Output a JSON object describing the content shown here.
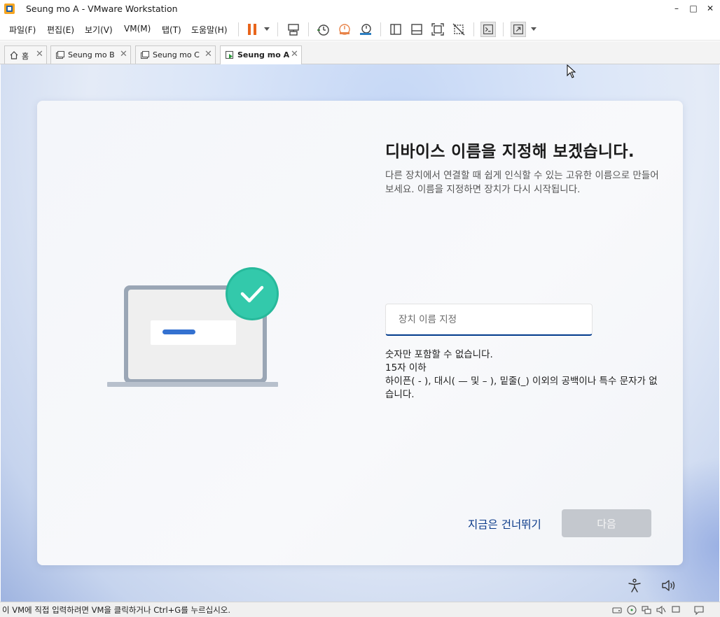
{
  "window": {
    "title": "Seung mo A - VMware Workstation",
    "minimize": "–",
    "maximize": "□",
    "close": "✕"
  },
  "menu": {
    "items": [
      "파일(F)",
      "편집(E)",
      "보기(V)",
      "VM(M)",
      "탭(T)",
      "도움말(H)"
    ]
  },
  "tabs": [
    {
      "label": "홈",
      "active": false
    },
    {
      "label": "Seung mo B",
      "active": false
    },
    {
      "label": "Seung mo C",
      "active": false
    },
    {
      "label": "Seung mo A",
      "active": true
    }
  ],
  "tab_close_glyph": "✕",
  "oobe": {
    "heading": "디바이스 이름을 지정해 보겠습니다.",
    "subtext": "다른 장치에서 연결할 때 쉽게 인식할 수 있는 고유한 이름으로 만들어 보세요. 이름을 지정하면 장치가 다시 시작됩니다.",
    "input_placeholder": "장치 이름 지정",
    "input_value": "",
    "rules": [
      "숫자만 포함할 수 없습니다.",
      "15자 이하",
      "하이픈( - ), 대시( — 및 – ), 밑줄(_) 이외의 공백이나 특수 문자가 없습니다."
    ],
    "skip_label": "지금은 건너뛰기",
    "next_label": "다음"
  },
  "statusbar": {
    "text": "이 VM에 직접 입력하려면 VM을 클릭하거나 Ctrl+G를 누르십시오."
  },
  "colors": {
    "accent": "#003a8c",
    "pause": "#e8651c",
    "check_badge": "#2ec4a8",
    "next_disabled": "#c4c8ce"
  }
}
